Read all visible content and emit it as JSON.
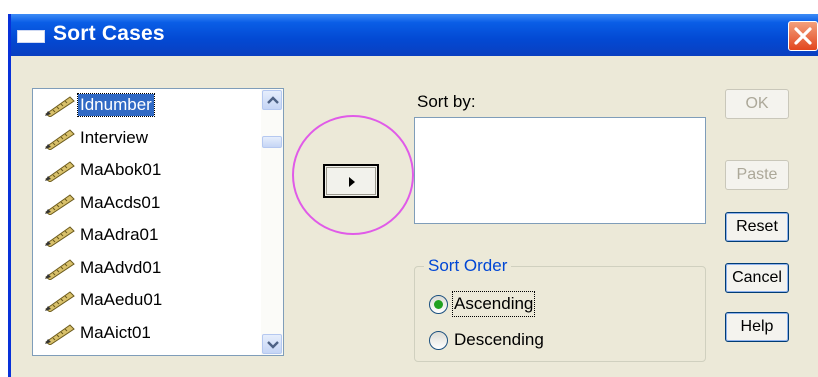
{
  "window": {
    "title": "Sort Cases"
  },
  "variables": {
    "items": [
      {
        "label": "Idnumber",
        "selected": true
      },
      {
        "label": "Interview",
        "selected": false
      },
      {
        "label": "MaAbok01",
        "selected": false
      },
      {
        "label": "MaAcds01",
        "selected": false
      },
      {
        "label": "MaAdra01",
        "selected": false
      },
      {
        "label": "MaAdvd01",
        "selected": false
      },
      {
        "label": "MaAedu01",
        "selected": false
      },
      {
        "label": "MaAict01",
        "selected": false
      }
    ],
    "icon": "ruler-pencil-icon"
  },
  "sort_by": {
    "label": "Sort by:"
  },
  "sort_order": {
    "label": "Sort Order",
    "options": [
      {
        "label": "Ascending",
        "selected": true
      },
      {
        "label": "Descending",
        "selected": false
      }
    ]
  },
  "buttons": {
    "ok": "OK",
    "paste": "Paste",
    "reset": "Reset",
    "cancel": "Cancel",
    "help": "Help"
  },
  "colors": {
    "titlebar": "#0a5ee6",
    "selection": "#316ac5",
    "highlight_circle": "#e05be8",
    "group_label": "#0046d5"
  }
}
